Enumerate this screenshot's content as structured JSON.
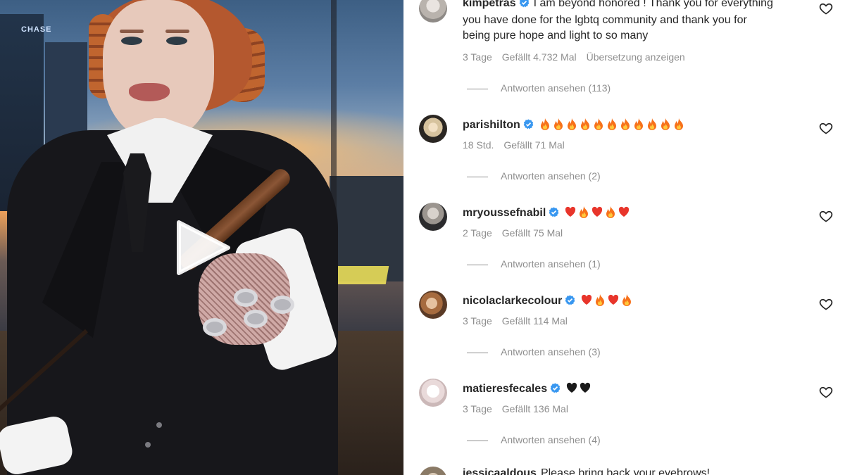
{
  "video": {
    "building_sign": "CHASE",
    "play_icon": "play-icon"
  },
  "comments": [
    {
      "username": "kimpetras",
      "verified": true,
      "text_line1": "I am beyond honored ! Thank you for everything",
      "text_line2": "you have done for the lgbtq community and thank you for",
      "text_line3": "being pure hope and light to so many",
      "time": "3 Tage",
      "likes": "Gefällt 4.732 Mal",
      "translate": "Übersetzung anzeigen",
      "replies": "Antworten ansehen (113)"
    },
    {
      "username": "parishilton",
      "verified": true,
      "emojis": [
        "fire",
        "fire",
        "fire",
        "fire",
        "fire",
        "fire",
        "fire",
        "fire",
        "fire",
        "fire",
        "fire"
      ],
      "time": "18 Std.",
      "likes": "Gefällt 71 Mal",
      "replies": "Antworten ansehen (2)"
    },
    {
      "username": "mryoussefnabil",
      "verified": true,
      "emojis": [
        "red-heart",
        "fire",
        "red-heart",
        "fire",
        "red-heart"
      ],
      "time": "2 Tage",
      "likes": "Gefällt 75 Mal",
      "replies": "Antworten ansehen (1)"
    },
    {
      "username": "nicolaclarkecolour",
      "verified": true,
      "emojis": [
        "red-heart",
        "fire",
        "red-heart",
        "fire"
      ],
      "time": "3 Tage",
      "likes": "Gefällt 114 Mal",
      "replies": "Antworten ansehen (3)"
    },
    {
      "username": "matieresfecales",
      "verified": true,
      "emojis": [
        "black-heart",
        "black-heart"
      ],
      "time": "3 Tage",
      "likes": "Gefällt 136 Mal",
      "replies": "Antworten ansehen (4)"
    },
    {
      "username": "jessicaaldous",
      "verified": false,
      "text_line1": "Please bring back your eyebrows!"
    }
  ],
  "colors": {
    "username": "#262626",
    "meta": "#8e8e8e",
    "verified": "#3897f0",
    "fire": "#f7711b",
    "red_heart": "#e8352b",
    "black_heart": "#1a1a1a"
  }
}
